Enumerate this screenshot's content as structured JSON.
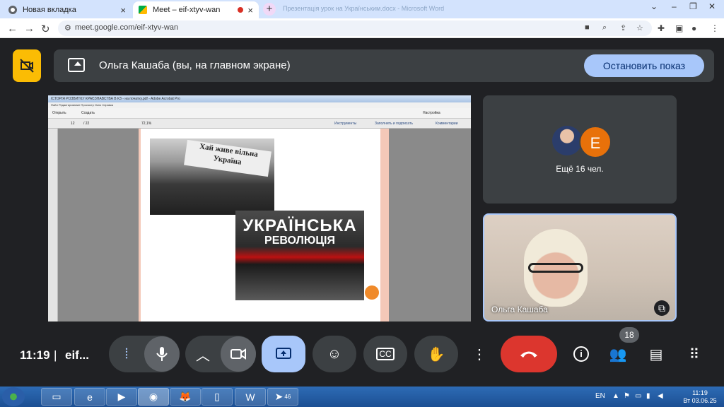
{
  "browser": {
    "tabs": [
      {
        "title": "Новая вкладка",
        "close": "×"
      },
      {
        "title": "Meet – eif-xtyv-wan",
        "close": "×"
      },
      {
        "title": "Презентація урок на Українським.docx - Microsoft Word"
      }
    ],
    "new_tab": "+",
    "url": "meet.google.com/eif-xtyv-wan",
    "window_controls": {
      "dropdown": "⌄",
      "minimize": "–",
      "maximize": "❐",
      "close": "✕"
    }
  },
  "meet": {
    "banner_text": "Ольга Кашаба (вы, на главном экране)",
    "stop_button": "Остановить показ",
    "shared_screen": {
      "pdf_title": "ІСТОРІЯ РОЗВИТКУ КРАЄЗНАВСТВА В КЗ - на початку.pdf - Adobe Acrobat Pro",
      "pdf_menu": "Файл  Редактирование  Просмотр  Окно  Справка",
      "open_label": "Открыть",
      "create_label": "Создать",
      "settings_label": "Настройка",
      "page_current": "12",
      "page_total": "/ 22",
      "zoom": "72,1%",
      "tools": "Инструменты",
      "fill_sign": "Заполнить и подписать",
      "comments": "Комментарии",
      "flag_text": "Хай живе вільна Україна",
      "slide_title": "УКРАЇНСЬКА",
      "slide_subtitle": "РЕВОЛЮЦІЯ"
    },
    "others_avatar_letter": "E",
    "others_label": "Ещё 16 чел.",
    "self_name": "Ольга Кашаба",
    "time": "11:19",
    "separator": "|",
    "meeting_code": "eif...",
    "participants_count": "18"
  },
  "taskbar": {
    "lang": "EN",
    "time": "11:19",
    "date": "Вт 03.06.25",
    "telegram_badge": "46"
  }
}
